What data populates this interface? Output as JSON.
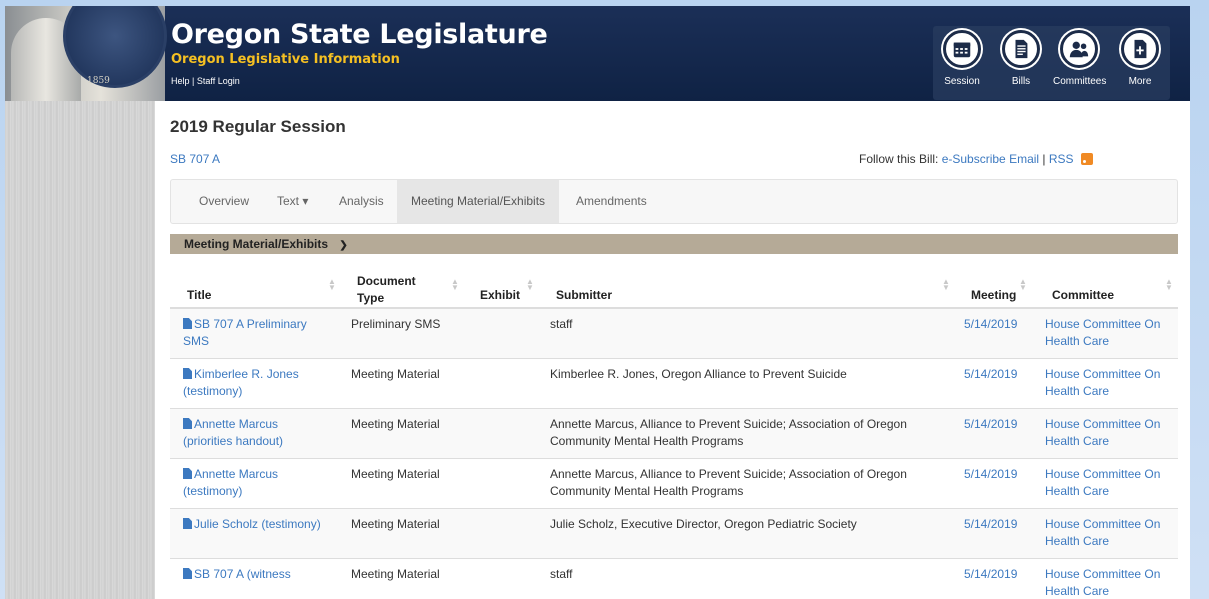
{
  "header": {
    "title": "Oregon State Legislature",
    "subtitle": "Oregon Legislative Information",
    "help_link": "Help",
    "separator": "|",
    "staff_login": "Staff Login",
    "seal_year": "1859",
    "nav": [
      {
        "label": "Session",
        "icon": "calendar-icon"
      },
      {
        "label": "Bills",
        "icon": "document-icon"
      },
      {
        "label": "Committees",
        "icon": "people-icon"
      },
      {
        "label": "More",
        "icon": "add-document-icon"
      }
    ]
  },
  "page": {
    "session": "2019 Regular Session",
    "bill_id": "SB 707 A",
    "follow_prefix": "Follow this Bill:",
    "subscribe_link": "e-Subscribe Email",
    "follow_sep": "|",
    "rss_link": "RSS"
  },
  "tabs": [
    {
      "label": "Overview"
    },
    {
      "label": "Text ▾"
    },
    {
      "label": "Analysis"
    },
    {
      "label": "Meeting Material/Exhibits",
      "active": true
    },
    {
      "label": "Amendments"
    }
  ],
  "section": {
    "title": "Meeting Material/Exhibits"
  },
  "table": {
    "headers": {
      "title": "Title",
      "doc_type_1": "Document",
      "doc_type_2": "Type",
      "exhibit": "Exhibit",
      "submitter": "Submitter",
      "meeting": "Meeting",
      "committee": "Committee"
    },
    "rows": [
      {
        "title_1": "SB 707 A Preliminary",
        "title_2": "SMS",
        "type": "Preliminary SMS",
        "submitter_1": "staff",
        "submitter_2": "",
        "meeting": "5/14/2019",
        "committee_1": "House Committee On",
        "committee_2": "Health Care"
      },
      {
        "title_1": "Kimberlee R. Jones",
        "title_2": "(testimony)",
        "type": "Meeting Material",
        "submitter_1": "Kimberlee R. Jones, Oregon Alliance to Prevent Suicide",
        "submitter_2": "",
        "meeting": "5/14/2019",
        "committee_1": "House Committee On",
        "committee_2": "Health Care"
      },
      {
        "title_1": "Annette Marcus",
        "title_2": "(priorities handout)",
        "type": "Meeting Material",
        "submitter_1": "Annette Marcus, Alliance to Prevent Suicide; Association of Oregon",
        "submitter_2": "Community Mental Health Programs",
        "meeting": "5/14/2019",
        "committee_1": "House Committee On",
        "committee_2": "Health Care"
      },
      {
        "title_1": "Annette Marcus",
        "title_2": "(testimony)",
        "type": "Meeting Material",
        "submitter_1": "Annette Marcus, Alliance to Prevent Suicide; Association of Oregon",
        "submitter_2": "Community Mental Health Programs",
        "meeting": "5/14/2019",
        "committee_1": "House Committee On",
        "committee_2": "Health Care"
      },
      {
        "title_1": "Julie Scholz (testimony)",
        "title_2": "",
        "type": "Meeting Material",
        "submitter_1": "Julie Scholz, Executive Director, Oregon Pediatric Society",
        "submitter_2": "",
        "meeting": "5/14/2019",
        "committee_1": "House Committee On",
        "committee_2": "Health Care"
      },
      {
        "title_1": "SB 707 A (witness",
        "title_2": "",
        "type": "Meeting Material",
        "submitter_1": "staff",
        "submitter_2": "",
        "meeting": "5/14/2019",
        "committee_1": "House Committee On",
        "committee_2": "Health Care"
      }
    ]
  },
  "colors": {
    "header_bg": "#15294e",
    "subtitle": "#f5c022",
    "link": "#3c79c0",
    "section_bar": "#b5aa97"
  }
}
